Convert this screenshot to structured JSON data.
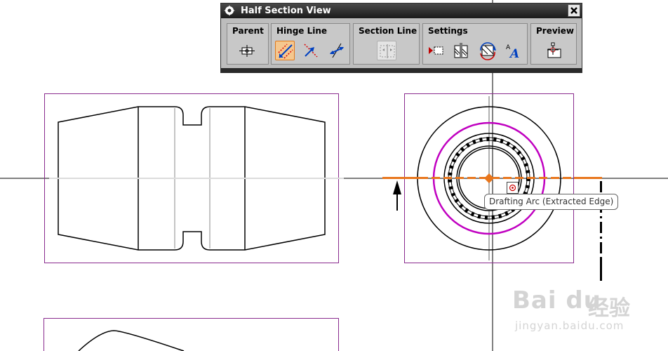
{
  "dialog": {
    "title": "Half Section View",
    "gear_icon": "gear-icon",
    "close_icon": "close-icon",
    "groups": {
      "parent": {
        "label": "Parent"
      },
      "hinge": {
        "label": "Hinge Line"
      },
      "section": {
        "label": "Section Line"
      },
      "settings": {
        "label": "Settings"
      },
      "preview": {
        "label": "Preview"
      }
    }
  },
  "tooltip": {
    "text": "Drafting Arc (Extracted Edge)"
  },
  "watermark": {
    "brand": "Bai du",
    "cn": "经验",
    "url": "jingyan.baidu.com"
  },
  "colors": {
    "section_line": "#e8761c",
    "view_border": "#8a2b8e",
    "arc_highlight": "#c000c0"
  }
}
